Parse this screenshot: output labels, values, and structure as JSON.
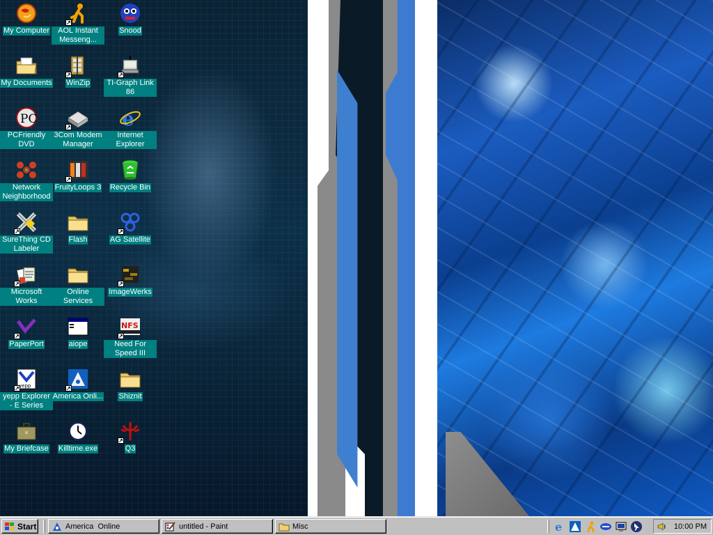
{
  "desktop": {
    "icons": [
      {
        "label": "My Computer",
        "icon": "my-computer-icon"
      },
      {
        "label": "AOL Instant Messeng...",
        "icon": "aim-icon"
      },
      {
        "label": "Snood",
        "icon": "snood-icon"
      },
      {
        "label": "My Documents",
        "icon": "my-documents-icon"
      },
      {
        "label": "WinZip",
        "icon": "winzip-icon"
      },
      {
        "label": "TI-Graph Link 86",
        "icon": "ti-graph-link-icon"
      },
      {
        "label": "PCFriendly DVD",
        "icon": "pcfriendly-dvd-icon"
      },
      {
        "label": "3Com Modem Manager",
        "icon": "modem-manager-icon"
      },
      {
        "label": "Internet Explorer",
        "icon": "internet-explorer-icon"
      },
      {
        "label": "Network Neighborhood",
        "icon": "network-neighborhood-icon"
      },
      {
        "label": "FruityLoops 3",
        "icon": "fruityloops-icon"
      },
      {
        "label": "Recycle Bin",
        "icon": "recycle-bin-icon"
      },
      {
        "label": "SureThing CD Labeler",
        "icon": "surething-icon"
      },
      {
        "label": "Flash",
        "icon": "folder-icon"
      },
      {
        "label": "AG Satellite",
        "icon": "ag-satellite-icon"
      },
      {
        "label": "Microsoft Works",
        "icon": "microsoft-works-icon"
      },
      {
        "label": "Online Services",
        "icon": "folder-icon"
      },
      {
        "label": "ImageWerks",
        "icon": "imagewerks-icon"
      },
      {
        "label": "PaperPort",
        "icon": "paperport-icon"
      },
      {
        "label": "aiope",
        "icon": "application-window-icon"
      },
      {
        "label": "Need For Speed III",
        "icon": "need-for-speed-icon"
      },
      {
        "label": "yepp Explorer - E Series",
        "icon": "yepp-explorer-icon"
      },
      {
        "label": "America Onli...",
        "icon": "america-online-icon"
      },
      {
        "label": "Shiznit",
        "icon": "folder-icon"
      },
      {
        "label": "My Briefcase",
        "icon": "briefcase-icon"
      },
      {
        "label": "Killtime.exe",
        "icon": "clock-icon"
      },
      {
        "label": "Q3",
        "icon": "quake3-icon"
      }
    ]
  },
  "taskbar": {
    "start_label": "Start",
    "tasks": [
      {
        "label": "America  Online",
        "icon": "america-online-icon"
      },
      {
        "label": "untitled - Paint",
        "icon": "paint-icon"
      },
      {
        "label": "Misc",
        "icon": "folder-icon"
      }
    ],
    "quick_launch": [
      "internet-explorer-icon",
      "america-online-icon",
      "aim-icon",
      "network-icon",
      "modem-icon",
      "cursor-icon"
    ],
    "tray": {
      "clock": "10:00 PM",
      "icon": "volume-icon"
    }
  },
  "colors": {
    "icon_label_bg": "#008080",
    "taskbar": "#c0c0c0"
  }
}
